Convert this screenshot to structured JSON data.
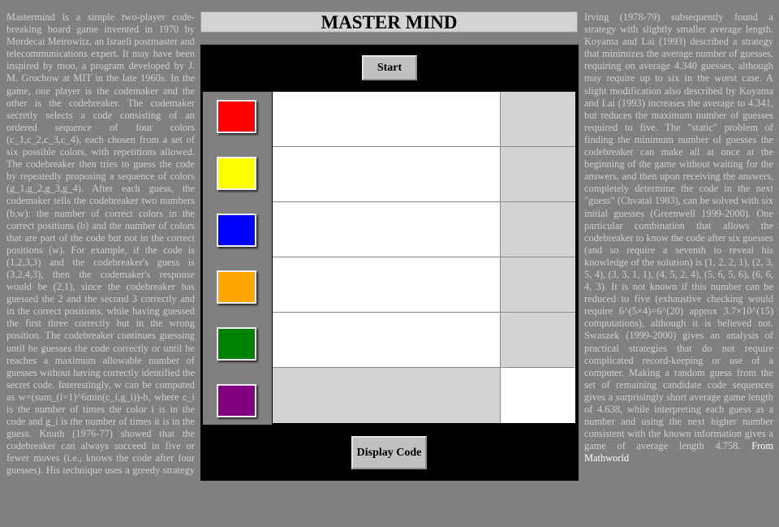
{
  "title": "MASTER MIND",
  "left_text": "Mastermind is a simple two-player code-breaking board game invented in 1970 by Mordecai Meirowitz, an Israeli postmaster and telecommunications expert. It may have been inspired by moo, a program developed by J. M. Grochow at MIT in the late 1960s. In the game, one player is the codemaker and the other is the codebreaker. The codemaker secretly selects a code consisting of an ordered sequence of four colors (c_1,c_2,c_3,c_4), each chosen from a set of six possible colors, with repetitions allowed. The codebreaker then tries to guess the code by repeatedly proposing a sequence of colors (g_1,g_2,g_3,g_4). After each guess, the codemaker tells the codebreaker two numbers (b,w): the number of correct colors in the correct positions (b) and the number of colors that are part of the code but not in the correct positions (w). For example, if the code is (1,2,3,3) and the codebreaker's guess is (3,2,4,3), then the codemaker's response would be (2,1), since the codebreaker has guessed the 2 and the second 3 correctly and in the correct positions, while having guessed the first three correctly but in the wrong position. The codebreaker continues guessing until he guesses the code correctly or until he reaches a maximum allowable number of guesses without having correctly identified the secret code. Interestingly, w can be computed as w=(sum_(i=1)^6min(c_i,g_i))-b, where c_i is the number of times the color i is in the code and g_i is the number of times it is in the guess. Knuth (1976-77) showed that the codebreaker can always succeed in five or fewer moves (i.e., knows the code after four guesses). His technique uses a greedy strategy that minimizes the number of remaining",
  "right_text": "Irving (1978-79) subsequently found a strategy with slightly smaller average length. Koyama and Lai (1993) described a strategy that minimizes the average number of guesses, requiring on average 4.340 guesses, although may require up to six in the worst case. A slight modification also described by Koyama and Lai (1993) increases the average to 4.341, but reduces the maximum number of guesses required to five. The \"static\" problem of finding the minimum number of guesses the codebreaker can make all at once at the beginning of the game without waiting for the answers, and then upon receiving the answers, completely determine the code in the next \"guess\" (Chvatal 1983), can be solved with six initial guesses (Greenwell 1999-2000). One particular combination that allows the codebreaker to know the code after six guesses (and so require a seventh to reveal his knowledge of the solution) is (1, 2, 2, 1), (2, 3, 5, 4), (3, 3, 1, 1), (4, 5, 2, 4), (5, 6, 5, 6), (6, 6, 4, 3). It is not known if this number can be reduced to five (exhaustive checking would require 6^(5×4)=6^(20) approx 3.7×10^(15) computations), although it is believed not. Swaszek (1999-2000) gives an analysis of practical strategies that do not require complicated record-keeping or use of a computer. Making a random guess from the set of remaining candidate code sequences gives a surprisingly short average game length of 4.638, while interpreting each guess as a number and using the next higher number consistent with the known information gives a game of average length 4.758.",
  "right_text_link": "From Mathworld",
  "buttons": {
    "start": "Start",
    "display": "Display Code"
  },
  "palette": [
    {
      "name": "red",
      "color": "#ff0000"
    },
    {
      "name": "yellow",
      "color": "#ffff00"
    },
    {
      "name": "blue",
      "color": "#0000ff"
    },
    {
      "name": "orange",
      "color": "#ffa500"
    },
    {
      "name": "green",
      "color": "#008000"
    },
    {
      "name": "purple",
      "color": "#800080"
    }
  ],
  "rows": [
    {
      "guess_bg": "#ffffff",
      "score_bg": "#d3d3d3"
    },
    {
      "guess_bg": "#ffffff",
      "score_bg": "#d3d3d3"
    },
    {
      "guess_bg": "#ffffff",
      "score_bg": "#d3d3d3"
    },
    {
      "guess_bg": "#ffffff",
      "score_bg": "#d3d3d3"
    },
    {
      "guess_bg": "#ffffff",
      "score_bg": "#d3d3d3"
    },
    {
      "guess_bg": "#d3d3d3",
      "score_bg": "#ffffff"
    }
  ]
}
